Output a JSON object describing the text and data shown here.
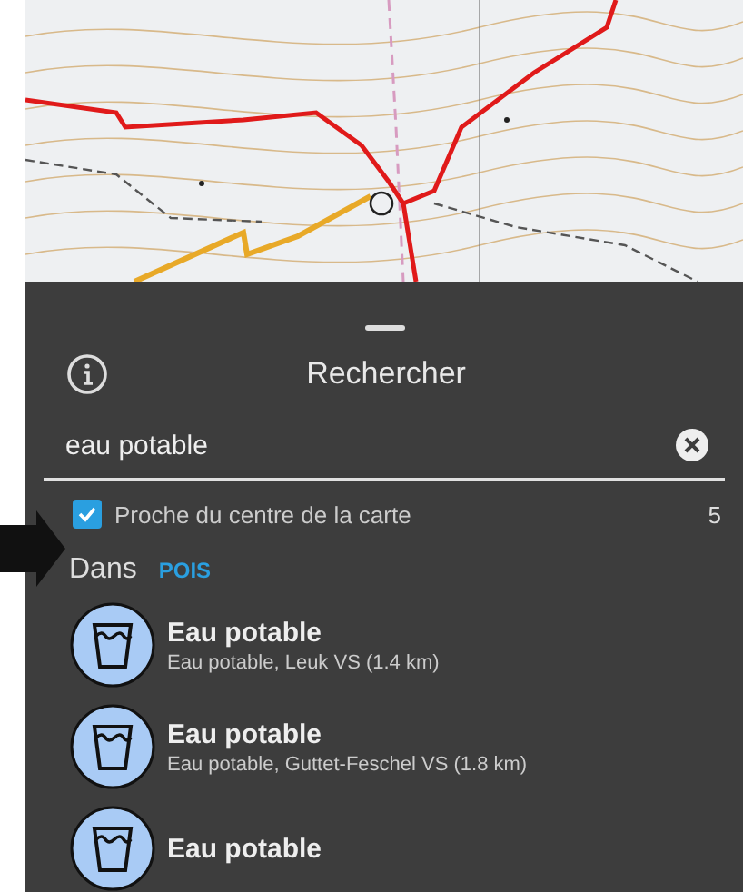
{
  "panel": {
    "title": "Rechercher"
  },
  "search": {
    "value": "eau potable"
  },
  "filter": {
    "label": "Proche du centre de la carte",
    "checked": true,
    "count": "5"
  },
  "scope": {
    "label": "Dans",
    "value": "POIS"
  },
  "results": [
    {
      "title": "Eau potable",
      "subtitle": "Eau potable, Leuk VS (1.4 km)"
    },
    {
      "title": "Eau potable",
      "subtitle": "Eau potable, Guttet-Feschel VS (1.8 km)"
    },
    {
      "title": "Eau potable"
    }
  ]
}
